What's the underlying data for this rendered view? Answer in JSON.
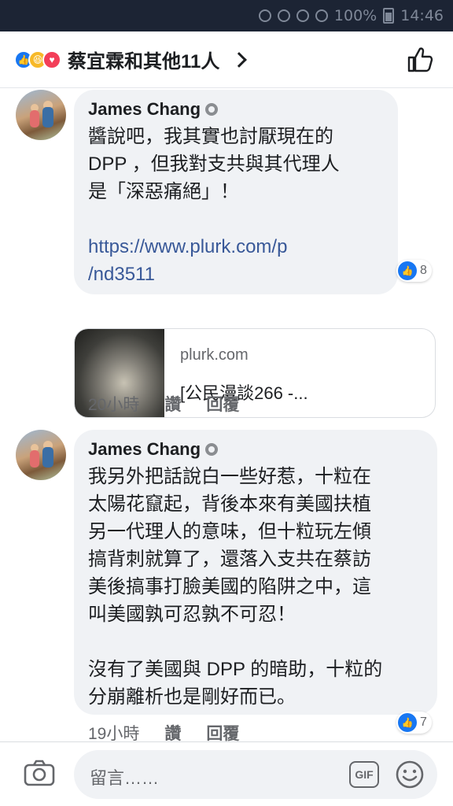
{
  "status_bar": {
    "battery": "100%",
    "time": "14:46"
  },
  "header": {
    "title": "蔡宜霖和其他11人"
  },
  "comments": [
    {
      "author": "James Chang",
      "text_lines": [
        "醬說吧，我其實也討厭現在的",
        "DPP ，但我對支共與其代理人",
        "是「深惡痛絕」！"
      ],
      "link_lines": [
        "https://www.plurk.com/p",
        "/nd3511"
      ],
      "like_count": "8",
      "preview": {
        "domain": "plurk.com",
        "title": "[公民漫談266 -..."
      },
      "time": "20小時",
      "like_label": "讚",
      "reply_label": "回覆"
    },
    {
      "author": "James Chang",
      "text_lines": [
        "我另外把話說白一些好惹，十粒在",
        "太陽花竄起，背後本來有美國扶植",
        "另一代理人的意味，但十粒玩左傾",
        "搞背刺就算了，還落入支共在蔡訪",
        "美後搞事打臉美國的陷阱之中，這",
        "叫美國孰可忍孰不可忍！",
        "",
        "沒有了美國與 DPP 的暗助，十粒的",
        "分崩離析也是剛好而已。"
      ],
      "like_count": "7",
      "time": "19小時",
      "like_label": "讚",
      "reply_label": "回覆"
    }
  ],
  "composer": {
    "placeholder": "留言……",
    "gif_label": "GIF"
  },
  "colors": {
    "like_blue": "#1877f2",
    "link": "#385898",
    "bubble": "#f0f2f5"
  }
}
